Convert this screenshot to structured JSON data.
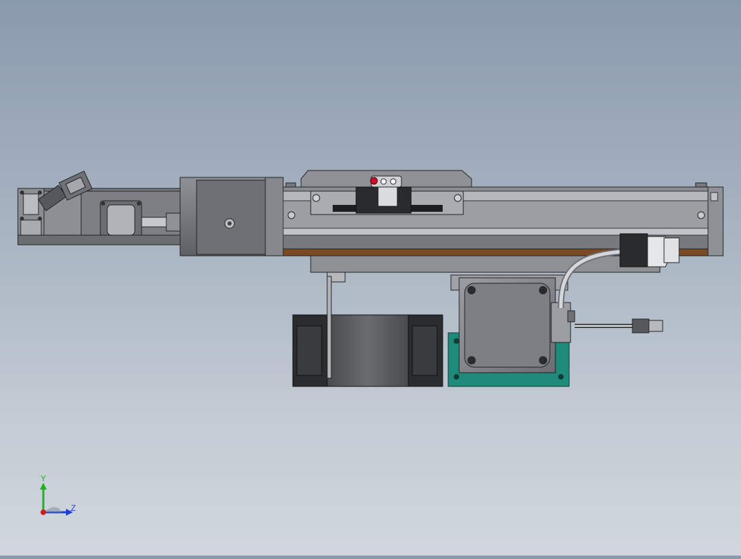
{
  "viewport": {
    "background_top": "#8a9aad",
    "background_bottom": "#d1d7dd"
  },
  "triad": {
    "y_label": "Y",
    "z_label": "Z",
    "y_color": "#1db31d",
    "z_color": "#1f3fd6",
    "x_color": "#d11a1a"
  },
  "model": {
    "indicator_color": "#c8102e",
    "bracket_color": "#1e8a7a",
    "strip_color": "#7a4a22",
    "part_color": "#6d7075"
  }
}
